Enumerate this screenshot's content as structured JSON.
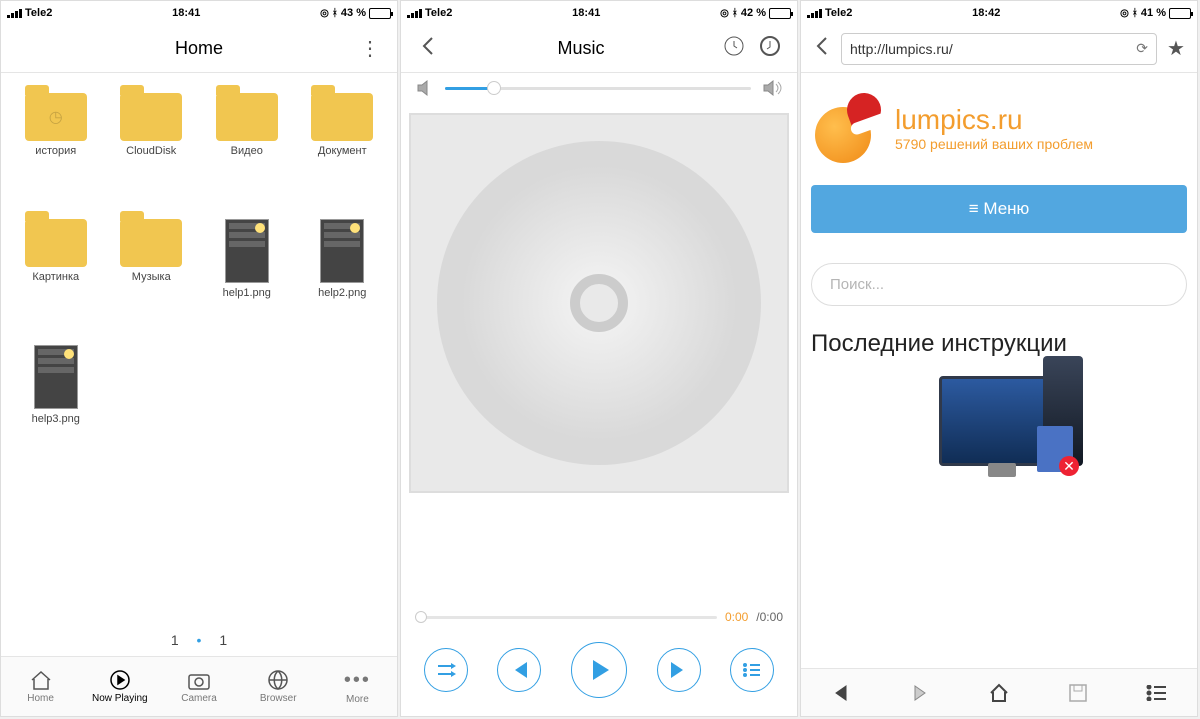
{
  "screens": [
    {
      "status": {
        "carrier": "Tele2",
        "time": "18:41",
        "battery_pct": "43 %",
        "bt": "✻",
        "alarm": "⊙"
      },
      "title": "Home",
      "folders": [
        {
          "label": "история",
          "icon": "clock"
        },
        {
          "label": "CloudDisk",
          "icon": ""
        },
        {
          "label": "Видео",
          "icon": ""
        },
        {
          "label": "Документ",
          "icon": ""
        },
        {
          "label": "Картинка",
          "icon": ""
        },
        {
          "label": "Музыка",
          "icon": ""
        }
      ],
      "files": [
        {
          "label": "help1.png"
        },
        {
          "label": "help2.png"
        },
        {
          "label": "help3.png"
        }
      ],
      "pager": {
        "current": "1",
        "total": "1"
      },
      "tabs": [
        {
          "label": "Home"
        },
        {
          "label": "Now Playing"
        },
        {
          "label": "Camera"
        },
        {
          "label": "Browser"
        },
        {
          "label": "More"
        }
      ],
      "active_tab": 1
    },
    {
      "status": {
        "carrier": "Tele2",
        "time": "18:41",
        "battery_pct": "42 %"
      },
      "title": "Music",
      "volume_pct": 16,
      "time_current": "0:00",
      "time_duration": "/0:00"
    },
    {
      "status": {
        "carrier": "Tele2",
        "time": "18:42",
        "battery_pct": "41 %"
      },
      "url": "http://lumpics.ru/",
      "brand_name": "lumpics.ru",
      "brand_tagline": "5790 решений ваших проблем",
      "menu_label": "Меню",
      "search_placeholder": "Поиск...",
      "section_heading": "Последние инструкции"
    }
  ]
}
